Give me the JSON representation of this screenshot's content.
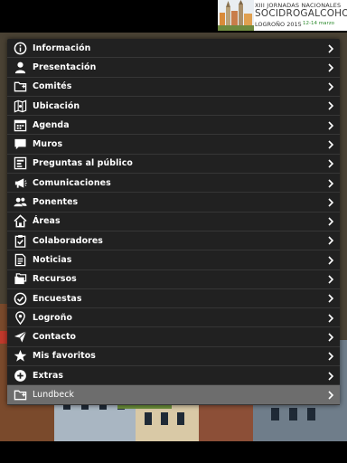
{
  "header": {
    "logo": {
      "line1": "XIII JORNADAS NACIONALES",
      "line2": "SOCIDROGALCOHOL",
      "line3": "LOGROÑO 2015",
      "line4": "12-14 marzo"
    }
  },
  "menu": {
    "items": [
      {
        "label": "Información",
        "icon": "info-icon"
      },
      {
        "label": "Presentación",
        "icon": "person-icon"
      },
      {
        "label": "Comités",
        "icon": "folder-add-icon"
      },
      {
        "label": "Ubicación",
        "icon": "map-icon"
      },
      {
        "label": "Agenda",
        "icon": "calendar-icon"
      },
      {
        "label": "Muros",
        "icon": "chat-bubble-icon"
      },
      {
        "label": "Preguntas al público",
        "icon": "poll-icon"
      },
      {
        "label": "Comunicaciones",
        "icon": "megaphone-icon"
      },
      {
        "label": "Ponentes",
        "icon": "speakers-icon"
      },
      {
        "label": "Áreas",
        "icon": "home-icon"
      },
      {
        "label": "Colaboradores",
        "icon": "clipboard-check-icon"
      },
      {
        "label": "Noticias",
        "icon": "news-icon"
      },
      {
        "label": "Recursos",
        "icon": "folders-icon"
      },
      {
        "label": "Encuestas",
        "icon": "check-circle-icon"
      },
      {
        "label": "Logroño",
        "icon": "location-pin-icon"
      },
      {
        "label": "Contacto",
        "icon": "paper-plane-icon"
      },
      {
        "label": "Mis favoritos",
        "icon": "star-icon"
      },
      {
        "label": "Extras",
        "icon": "plus-circle-icon"
      },
      {
        "label": "Lundbeck",
        "icon": "folder-add-icon",
        "active": true
      }
    ]
  },
  "colors": {
    "panel": "#212121",
    "divider": "#363636",
    "active_row": "#6d6d6d",
    "text": "#ffffff",
    "logo_accent": "#2d8b2d"
  }
}
